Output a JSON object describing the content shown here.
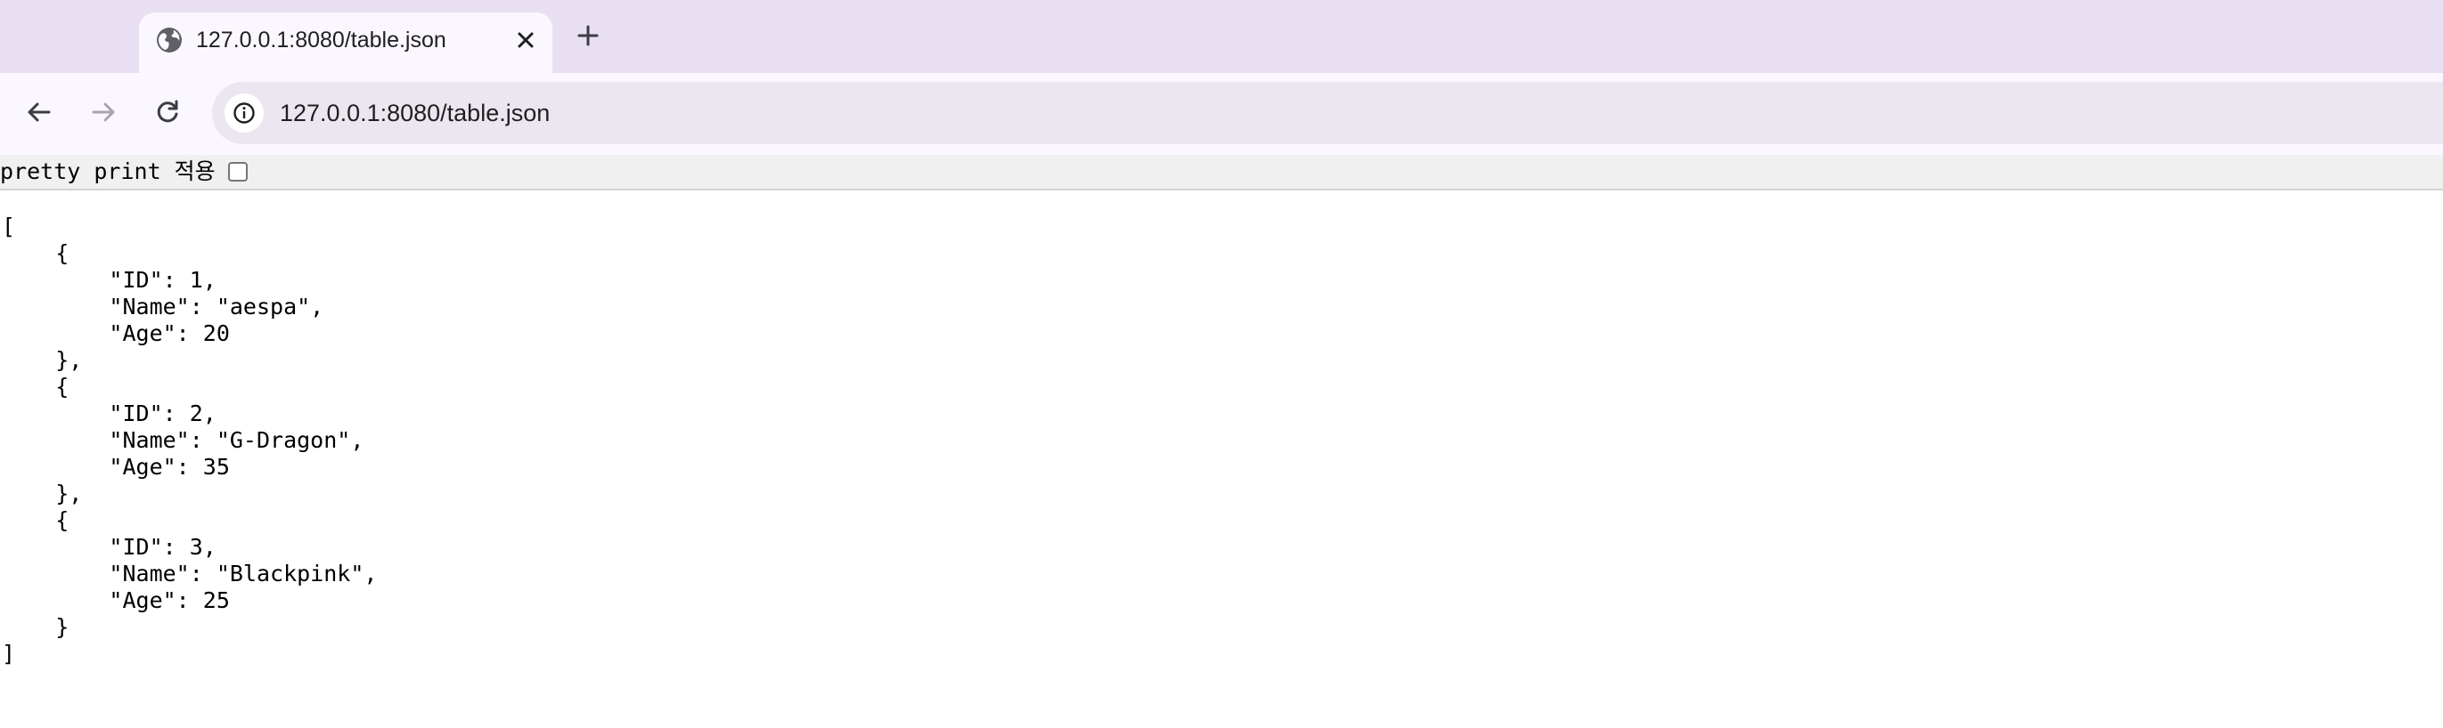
{
  "browser": {
    "tab": {
      "title": "127.0.0.1:8080/table.json",
      "favicon": "globe-icon"
    },
    "new_tab_icon": "plus-icon",
    "nav": {
      "back_icon": "arrow-left-icon",
      "forward_icon": "arrow-right-icon",
      "reload_icon": "reload-icon"
    },
    "address": {
      "url": "127.0.0.1:8080/table.json",
      "site_info_icon": "info-icon"
    }
  },
  "viewer": {
    "pretty_print_label": "pretty print 적용",
    "pretty_print_checked": false
  },
  "json_lines": [
    "[",
    "    {",
    "        \"ID\": 1,",
    "        \"Name\": \"aespa\",",
    "        \"Age\": 20",
    "    },",
    "    {",
    "        \"ID\": 2,",
    "        \"Name\": \"G-Dragon\",",
    "        \"Age\": 35",
    "    },",
    "    {",
    "        \"ID\": 3,",
    "        \"Name\": \"Blackpink\",",
    "        \"Age\": 25",
    "    }",
    "]"
  ],
  "colors": {
    "tabbar_bg": "#e8dff2",
    "toolbar_bg": "#fbf7fe",
    "omnibox_bg": "#ece6f0"
  }
}
